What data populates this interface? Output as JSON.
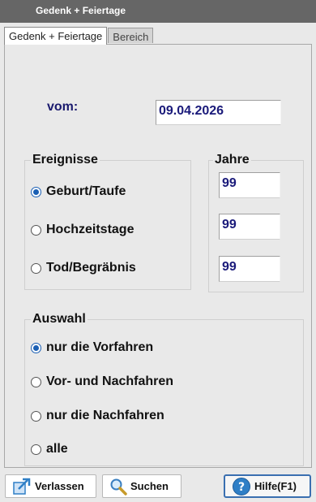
{
  "window": {
    "title": "Gedenk + Feiertage"
  },
  "tabs": [
    {
      "label": "Gedenk + Feiertage",
      "active": true
    },
    {
      "label": "Bereich",
      "active": false
    }
  ],
  "vom": {
    "label": "vom:",
    "value": "09.04.2026"
  },
  "ereignisse": {
    "title": "Ereignisse",
    "options": [
      {
        "label": "Geburt/Taufe",
        "selected": true
      },
      {
        "label": "Hochzeitstage",
        "selected": false
      },
      {
        "label": "Tod/Begräbnis",
        "selected": false
      }
    ]
  },
  "jahre": {
    "title": "Jahre",
    "values": [
      "99",
      "99",
      "99"
    ]
  },
  "auswahl": {
    "title": "Auswahl",
    "options": [
      {
        "label": "nur die Vorfahren",
        "selected": true
      },
      {
        "label": "Vor- und Nachfahren",
        "selected": false
      },
      {
        "label": "nur die Nachfahren",
        "selected": false
      },
      {
        "label": "alle",
        "selected": false
      }
    ]
  },
  "buttons": {
    "exit": {
      "label": "Verlassen",
      "icon": "exit-arrow-icon"
    },
    "search": {
      "label": "Suchen",
      "icon": "magnifier-icon"
    },
    "help": {
      "label": "Hilfe(F1)",
      "icon": "help-icon"
    }
  },
  "colors": {
    "accent": "#1a5fb4",
    "value_text": "#1a1a7a",
    "titlebar": "#666666"
  }
}
